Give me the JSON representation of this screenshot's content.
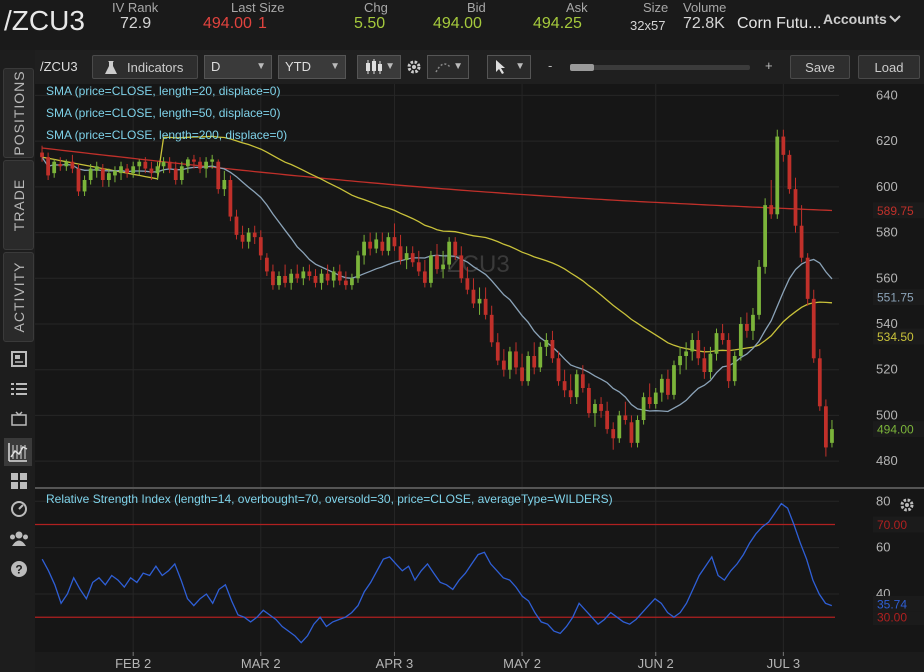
{
  "topbar": {
    "symbol": "/ZCU3",
    "fields": [
      {
        "label": "IV Rank",
        "value": "72.9",
        "color": "#d4d4d4"
      },
      {
        "label": "Last Size",
        "value": "494.00",
        "value2": "1",
        "color": "#e0433e"
      },
      {
        "label": "Chg",
        "value": "5.50",
        "color": "#a5c93c"
      },
      {
        "label": "Bid",
        "value": "494.00",
        "color": "#a5c93c"
      },
      {
        "label": "Ask",
        "value": "494.25",
        "color": "#a5c93c"
      },
      {
        "label": "Size",
        "value": "32x57",
        "color": "#d4d4d4"
      },
      {
        "label": "Volume",
        "value": "72.8K",
        "color": "#d4d4d4"
      }
    ],
    "description": "Corn Futu...",
    "accounts_label": "Accounts"
  },
  "sidebar": {
    "tabs": [
      "POSITIONS",
      "TRADE",
      "ACTIVITY"
    ],
    "icons": [
      "news-icon",
      "list-icon",
      "tv-icon",
      "chart-icon",
      "grid-icon",
      "dashboard-icon",
      "community-icon",
      "help-icon"
    ]
  },
  "toolbar": {
    "symbol": "/ZCU3",
    "indicators_label": "Indicators",
    "aggregation": "D",
    "range": "YTD",
    "zoom_minus": "-",
    "zoom_plus": "+",
    "save_label": "Save",
    "load_label": "Load"
  },
  "colors": {
    "up": "#7bb43a",
    "down": "#c0302a",
    "sma20": "#8ba3b8",
    "sma50": "#c9c23a",
    "sma200": "#c0302a",
    "rsi": "#2f5fd6",
    "level": "#b02020"
  },
  "chart_data": [
    {
      "type": "candlestick",
      "title": "/ZCU3",
      "watermark": "/ZCU3",
      "legend": [
        "SMA (price=CLOSE, length=20, displace=0)",
        "SMA (price=CLOSE, length=50, displace=0)",
        "SMA (price=CLOSE, length=200, displace=0)"
      ],
      "ylim": [
        470,
        645
      ],
      "yticks": [
        480,
        500,
        520,
        540,
        560,
        580,
        600,
        620,
        640
      ],
      "xticks": [
        "FEB 2",
        "MAR 2",
        "APR 3",
        "MAY 2",
        "JUN 2",
        "JUL 3"
      ],
      "xtick_index": [
        15,
        36,
        58,
        79,
        101,
        122
      ],
      "price_tags": [
        {
          "value": "589.75",
          "color": "#c0302a",
          "y": 589.75
        },
        {
          "value": "551.75",
          "color": "#8ba3b8",
          "y": 551.75
        },
        {
          "value": "534.50",
          "color": "#c9c23a",
          "y": 534.5
        },
        {
          "value": "494.00",
          "color": "#7bb43a",
          "y": 494.0
        }
      ],
      "candles": [
        [
          615,
          618,
          611,
          613
        ],
        [
          613,
          615,
          603,
          605
        ],
        [
          606,
          612,
          604,
          611
        ],
        [
          610,
          613,
          607,
          609
        ],
        [
          609,
          612,
          607,
          611
        ],
        [
          611,
          614,
          606,
          608
        ],
        [
          608,
          610,
          596,
          598
        ],
        [
          598,
          605,
          596,
          603
        ],
        [
          603,
          610,
          601,
          608
        ],
        [
          607,
          611,
          604,
          609
        ],
        [
          608,
          610,
          600,
          603
        ],
        [
          603,
          608,
          600,
          606
        ],
        [
          605,
          609,
          602,
          607
        ],
        [
          606,
          611,
          603,
          609
        ],
        [
          608,
          610,
          604,
          606
        ],
        [
          606,
          611,
          604,
          609
        ],
        [
          609,
          612,
          605,
          611
        ],
        [
          611,
          613,
          606,
          608
        ],
        [
          608,
          611,
          603,
          606
        ],
        [
          606,
          611,
          603,
          609
        ],
        [
          609,
          613,
          606,
          611
        ],
        [
          611,
          613,
          606,
          608
        ],
        [
          608,
          611,
          601,
          603
        ],
        [
          603,
          611,
          601,
          609
        ],
        [
          609,
          613,
          606,
          612
        ],
        [
          612,
          614,
          608,
          611
        ],
        [
          611,
          613,
          606,
          608
        ],
        [
          608,
          613,
          604,
          611
        ],
        [
          611,
          614,
          608,
          612
        ],
        [
          611,
          612,
          597,
          599
        ],
        [
          599,
          607,
          596,
          603
        ],
        [
          603,
          605,
          585,
          587
        ],
        [
          587,
          590,
          577,
          579
        ],
        [
          579,
          583,
          573,
          576
        ],
        [
          576,
          582,
          573,
          580
        ],
        [
          580,
          583,
          575,
          578
        ],
        [
          578,
          581,
          568,
          570
        ],
        [
          569,
          571,
          561,
          563
        ],
        [
          563,
          566,
          555,
          557
        ],
        [
          557,
          563,
          555,
          561
        ],
        [
          561,
          566,
          556,
          558
        ],
        [
          558,
          564,
          555,
          562
        ],
        [
          562,
          566,
          558,
          560
        ],
        [
          560,
          565,
          557,
          563
        ],
        [
          563,
          566,
          559,
          561
        ],
        [
          561,
          564,
          556,
          558
        ],
        [
          558,
          564,
          555,
          562
        ],
        [
          562,
          566,
          557,
          559
        ],
        [
          559,
          565,
          556,
          563
        ],
        [
          563,
          566,
          557,
          559
        ],
        [
          559,
          563,
          555,
          557
        ],
        [
          557,
          562,
          555,
          560
        ],
        [
          560,
          572,
          558,
          570
        ],
        [
          570,
          579,
          566,
          576
        ],
        [
          576,
          580,
          570,
          573
        ],
        [
          573,
          580,
          571,
          577
        ],
        [
          576,
          580,
          570,
          572
        ],
        [
          572,
          580,
          570,
          578
        ],
        [
          578,
          584,
          572,
          574
        ],
        [
          574,
          579,
          566,
          568
        ],
        [
          568,
          574,
          564,
          571
        ],
        [
          571,
          574,
          565,
          567
        ],
        [
          567,
          572,
          561,
          563
        ],
        [
          563,
          568,
          556,
          558
        ],
        [
          558,
          572,
          556,
          570
        ],
        [
          570,
          575,
          562,
          564
        ],
        [
          564,
          572,
          560,
          566
        ],
        [
          566,
          578,
          564,
          576
        ],
        [
          576,
          578,
          568,
          570
        ],
        [
          570,
          574,
          558,
          560
        ],
        [
          560,
          565,
          553,
          555
        ],
        [
          555,
          560,
          547,
          549
        ],
        [
          549,
          556,
          544,
          551
        ],
        [
          551,
          556,
          542,
          544
        ],
        [
          544,
          548,
          530,
          532
        ],
        [
          532,
          536,
          522,
          524
        ],
        [
          524,
          529,
          517,
          520
        ],
        [
          520,
          530,
          516,
          528
        ],
        [
          528,
          532,
          518,
          521
        ],
        [
          521,
          527,
          513,
          515
        ],
        [
          515,
          528,
          513,
          526
        ],
        [
          526,
          532,
          518,
          521
        ],
        [
          521,
          532,
          519,
          530
        ],
        [
          530,
          536,
          526,
          533
        ],
        [
          533,
          537,
          523,
          525
        ],
        [
          525,
          528,
          513,
          515
        ],
        [
          515,
          520,
          508,
          511
        ],
        [
          511,
          518,
          505,
          508
        ],
        [
          508,
          520,
          505,
          518
        ],
        [
          518,
          522,
          510,
          512
        ],
        [
          512,
          514,
          499,
          501
        ],
        [
          501,
          507,
          495,
          505
        ],
        [
          505,
          508,
          499,
          502
        ],
        [
          502,
          506,
          492,
          494
        ],
        [
          494,
          497,
          485,
          490
        ],
        [
          490,
          502,
          488,
          500
        ],
        [
          500,
          506,
          496,
          498
        ],
        [
          497,
          500,
          486,
          488
        ],
        [
          488,
          500,
          486,
          498
        ],
        [
          498,
          510,
          496,
          508
        ],
        [
          508,
          514,
          503,
          505
        ],
        [
          505,
          512,
          503,
          510
        ],
        [
          510,
          518,
          506,
          516
        ],
        [
          516,
          520,
          507,
          509
        ],
        [
          509,
          524,
          507,
          522
        ],
        [
          522,
          530,
          518,
          526
        ],
        [
          526,
          532,
          520,
          528
        ],
        [
          528,
          536,
          524,
          533
        ],
        [
          533,
          537,
          522,
          525
        ],
        [
          525,
          530,
          516,
          519
        ],
        [
          519,
          530,
          516,
          527
        ],
        [
          527,
          538,
          524,
          536
        ],
        [
          536,
          540,
          531,
          533
        ],
        [
          533,
          536,
          512,
          515
        ],
        [
          515,
          528,
          513,
          526
        ],
        [
          526,
          543,
          524,
          540
        ],
        [
          540,
          545,
          534,
          537
        ],
        [
          537,
          547,
          533,
          544
        ],
        [
          544,
          568,
          542,
          565
        ],
        [
          565,
          595,
          562,
          592
        ],
        [
          592,
          603,
          586,
          588
        ],
        [
          588,
          625,
          586,
          622
        ],
        [
          622,
          625,
          611,
          614
        ],
        [
          614,
          616,
          597,
          599
        ],
        [
          599,
          604,
          580,
          583
        ],
        [
          583,
          592,
          567,
          569
        ],
        [
          569,
          571,
          548,
          551
        ],
        [
          551,
          555,
          523,
          525
        ],
        [
          525,
          529,
          502,
          504
        ],
        [
          504,
          507,
          482,
          486
        ],
        [
          488,
          498,
          486,
          494
        ]
      ]
    },
    {
      "type": "line",
      "title": "Relative Strength Index (length=14, overbought=70, oversold=30, price=CLOSE, averageType=WILDERS)",
      "ylim": [
        15,
        84
      ],
      "yticks": [
        40,
        60,
        80
      ],
      "overbought": 70,
      "oversold": 30,
      "level_tags": [
        {
          "value": "70.00",
          "color": "#b02020",
          "y": 70
        },
        {
          "value": "30.00",
          "color": "#b02020",
          "y": 30
        },
        {
          "value": "35.74",
          "color": "#2f5fd6",
          "y": 35.74
        }
      ],
      "values": [
        55,
        50,
        44,
        36,
        40,
        47,
        42,
        38,
        45,
        47,
        44,
        48,
        46,
        43,
        47,
        45,
        49,
        48,
        52,
        48,
        50,
        53,
        46,
        38,
        35,
        38,
        40,
        36,
        42,
        44,
        37,
        31,
        30,
        28,
        30,
        33,
        31,
        29,
        26,
        24,
        22,
        19,
        22,
        27,
        30,
        26,
        28,
        29,
        30,
        32,
        35,
        41,
        45,
        50,
        55,
        56,
        53,
        50,
        52,
        46,
        50,
        53,
        49,
        45,
        44,
        42,
        46,
        49,
        53,
        57,
        58,
        53,
        50,
        47,
        46,
        43,
        39,
        37,
        32,
        28,
        27,
        24,
        23,
        26,
        30,
        36,
        33,
        30,
        27,
        29,
        32,
        30,
        28,
        27,
        29,
        32,
        35,
        38,
        36,
        32,
        30,
        32,
        36,
        42,
        48,
        52,
        56,
        48,
        46,
        50,
        53,
        57,
        62,
        66,
        69,
        71,
        75,
        79,
        77,
        70,
        62,
        55,
        46,
        40,
        36,
        35
      ]
    }
  ]
}
